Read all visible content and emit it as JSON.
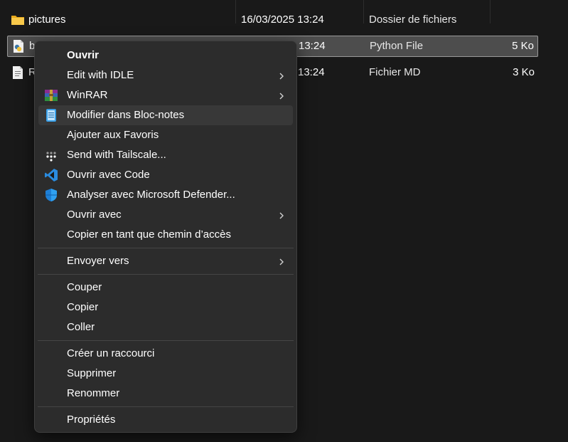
{
  "files": [
    {
      "name": "pictures",
      "date": "16/03/2025 13:24",
      "type": "Dossier de fichiers",
      "size": "",
      "icon": "folder-icon"
    },
    {
      "name": "b",
      "date": "13:24",
      "type": "Python File",
      "size": "5 Ko",
      "icon": "python-file-icon"
    },
    {
      "name": "R",
      "date": "13:24",
      "type": "Fichier MD",
      "size": "3 Ko",
      "icon": "text-file-icon"
    }
  ],
  "context_menu": {
    "items": [
      {
        "label": "Ouvrir",
        "icon": "",
        "submenu": false,
        "default": true
      },
      {
        "label": "Edit with IDLE",
        "icon": "",
        "submenu": true
      },
      {
        "label": "WinRAR",
        "icon": "winrar-icon",
        "submenu": true
      },
      {
        "label": "Modifier dans Bloc-notes",
        "icon": "notepad-icon",
        "submenu": false,
        "highlighted": true
      },
      {
        "label": "Ajouter aux Favoris",
        "icon": "",
        "submenu": false
      },
      {
        "label": "Send with Tailscale...",
        "icon": "tailscale-icon",
        "submenu": false
      },
      {
        "label": "Ouvrir avec Code",
        "icon": "vscode-icon",
        "submenu": false
      },
      {
        "label": "Analyser avec Microsoft Defender...",
        "icon": "defender-shield-icon",
        "submenu": false
      },
      {
        "label": "Ouvrir avec",
        "icon": "",
        "submenu": true
      },
      {
        "label": "Copier en tant que chemin d’accès",
        "icon": "",
        "submenu": false
      },
      {
        "label": "Envoyer vers",
        "icon": "",
        "submenu": true
      },
      {
        "label": "Couper",
        "icon": "",
        "submenu": false
      },
      {
        "label": "Copier",
        "icon": "",
        "submenu": false
      },
      {
        "label": "Coller",
        "icon": "",
        "submenu": false
      },
      {
        "label": "Créer un raccourci",
        "icon": "",
        "submenu": false
      },
      {
        "label": "Supprimer",
        "icon": "",
        "submenu": false
      },
      {
        "label": "Renommer",
        "icon": "",
        "submenu": false
      },
      {
        "label": "Propriétés",
        "icon": "",
        "submenu": false
      }
    ]
  },
  "colors": {
    "background": "#191919",
    "menu_background": "#2c2c2c",
    "menu_hover": "#383838",
    "selected_row": "#4d4d4d",
    "folder": "#f5c342",
    "vscode": "#2a8ce0",
    "defender": "#1e7fd6"
  }
}
